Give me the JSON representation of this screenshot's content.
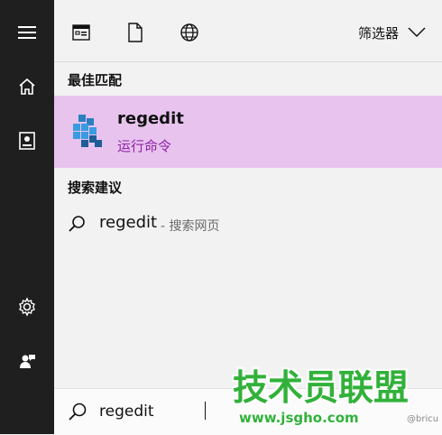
{
  "toolbar": {
    "filter_label": "筛选器",
    "icons": {
      "apps": "apps-window-icon",
      "documents": "document-icon",
      "web": "globe-icon",
      "filter": "chevron-down-icon"
    }
  },
  "sidebar": {
    "icons": [
      "hamburger-icon",
      "home-icon",
      "notebook-icon",
      "settings-icon",
      "feedback-icon"
    ]
  },
  "sections": {
    "best_match": "最佳匹配",
    "suggestions": "搜索建议"
  },
  "best_match": {
    "title": "regedit",
    "subtitle": "运行命令"
  },
  "suggestion": {
    "term": "regedit",
    "extra": "- 搜索网页"
  },
  "search": {
    "value": "regedit"
  },
  "watermark": {
    "main": "技术员联盟",
    "url": "www.jsgho.com",
    "sig": "@bricu"
  },
  "colors": {
    "sidebar": "#1f1f1f",
    "panel": "#f2f2f2",
    "best_match_bg": "#e8c3ee",
    "accent_purple": "#8d24a7",
    "watermark_green": "#31b13a"
  }
}
